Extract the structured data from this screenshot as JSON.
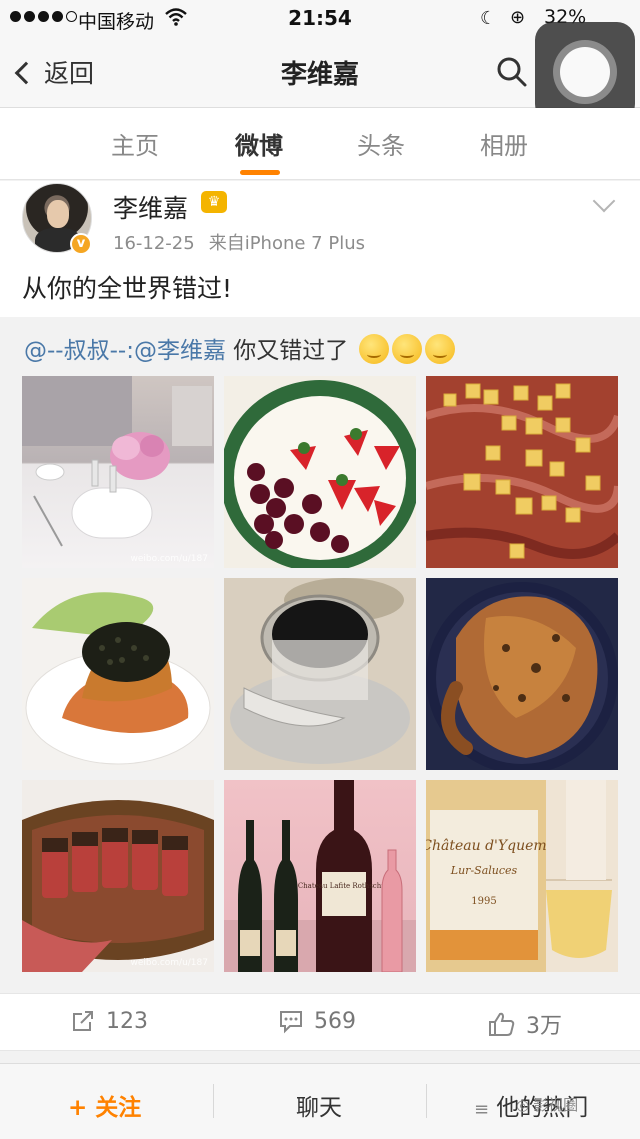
{
  "status_bar": {
    "carrier": "中国移动",
    "time": "21:54",
    "battery": "32%"
  },
  "nav": {
    "back_label": "返回",
    "title": "李维嘉"
  },
  "tabs": [
    {
      "label": "主页",
      "active": false
    },
    {
      "label": "微博",
      "active": true
    },
    {
      "label": "头条",
      "active": false
    },
    {
      "label": "相册",
      "active": false
    }
  ],
  "post": {
    "author": "李维嘉",
    "date": "16-12-25",
    "source": "来自iPhone 7 Plus",
    "text": "从你的全世界错过!",
    "repost": {
      "mention1": "@--叔叔--",
      "separator": ":",
      "mention2": "@李维嘉",
      "text": " 你又错过了",
      "emoji_count": 3
    },
    "photos": [
      {
        "name": "dining-table-flowers-photo",
        "caption": "weibo.com/u/187"
      },
      {
        "name": "strawberries-cherries-photo",
        "caption": ""
      },
      {
        "name": "ham-cheese-photo",
        "caption": ""
      },
      {
        "name": "caviar-dish-photo",
        "caption": ""
      },
      {
        "name": "caviar-tin-photo",
        "caption": ""
      },
      {
        "name": "roast-turkey-photo",
        "caption": ""
      },
      {
        "name": "sliced-steak-photo",
        "caption": "weibo.com/u/187"
      },
      {
        "name": "wine-bottles-photo",
        "caption": ""
      },
      {
        "name": "chateau-yquem-photo",
        "caption": ""
      }
    ],
    "wine_label": "Chateau Lafite Rothschild",
    "yquem_label": "Château d'Yquem",
    "yquem_sub": "Lur-Saluces",
    "yquem_year": "1995"
  },
  "actions": {
    "repost_count": "123",
    "comment_count": "569",
    "like_count": "3万"
  },
  "bottom_bar": {
    "follow": "关注",
    "chat": "聊天",
    "hot": "他的热门",
    "watermark": "影视圈"
  },
  "colors": {
    "accent": "#ff8200",
    "mention": "#4a78a8"
  }
}
